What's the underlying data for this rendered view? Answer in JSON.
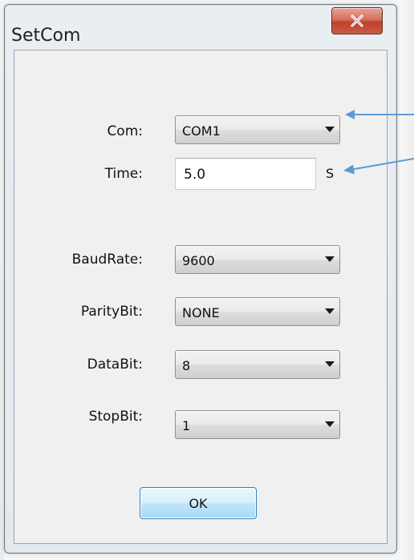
{
  "window": {
    "title": "SetCom"
  },
  "form": {
    "com": {
      "label": "Com:",
      "value": "COM1"
    },
    "time": {
      "label": "Time:",
      "value": "5.0",
      "unit": "S"
    },
    "baudrate": {
      "label": "BaudRate:",
      "value": "9600"
    },
    "paritybit": {
      "label": "ParityBit:",
      "value": "NONE"
    },
    "databit": {
      "label": "DataBit:",
      "value": "8"
    },
    "stopbit": {
      "label": "StopBit:",
      "value": "1"
    }
  },
  "buttons": {
    "ok_label": "OK"
  },
  "icons": {
    "close": "close-icon",
    "dropdown": "chevron-down-icon"
  },
  "colors": {
    "close_button": "#c94a36",
    "ok_button": "#bee6fd",
    "annotation_arrow": "#5b9bd5"
  }
}
